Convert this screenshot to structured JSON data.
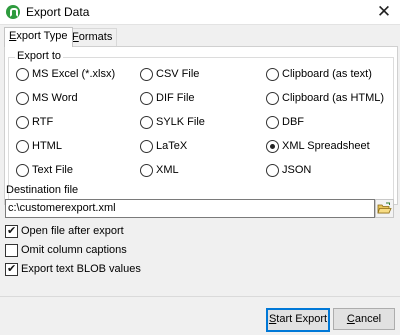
{
  "window": {
    "title": "Export Data",
    "close_glyph": "✕",
    "app_icon": "app-logo-icon"
  },
  "tabs": [
    {
      "label_parts": [
        "",
        "E",
        "xport Type"
      ],
      "active": true
    },
    {
      "label_parts": [
        "",
        "F",
        "ormats"
      ],
      "active": false
    }
  ],
  "export_to": {
    "title": "Export to",
    "selected": "XML Spreadsheet",
    "options": [
      "MS Excel (*.xlsx)",
      "CSV File",
      "Clipboard (as text)",
      "MS Word",
      "DIF File",
      "Clipboard (as HTML)",
      "RTF",
      "SYLK File",
      "DBF",
      "HTML",
      "LaTeX",
      "XML Spreadsheet",
      "Text File",
      "XML",
      "JSON"
    ]
  },
  "destination": {
    "label": "Destination file",
    "value": "c:\\customerexport.xml",
    "browse_icon": "folder-open-icon"
  },
  "options": [
    {
      "label": "Open file after export",
      "checked": true
    },
    {
      "label": "Omit column captions",
      "checked": false
    },
    {
      "label": "Export text BLOB values",
      "checked": true
    }
  ],
  "check_glyph": "✔",
  "buttons": {
    "start_export": {
      "label_parts": [
        "",
        "S",
        "tart Export"
      ],
      "default": true
    },
    "cancel": {
      "label_parts": [
        "",
        "C",
        "ancel"
      ],
      "default": false
    }
  }
}
